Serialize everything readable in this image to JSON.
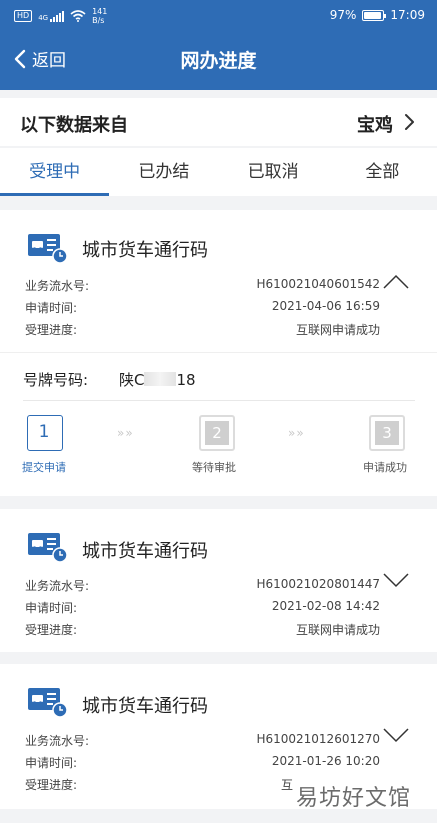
{
  "status_bar": {
    "net": "HD",
    "net_gen": "4G",
    "speed_value": "141",
    "speed_unit": "B/s",
    "battery": "97%",
    "time": "17:09",
    "battery_level": 0.97
  },
  "header": {
    "back_label": "返回",
    "title": "网办进度"
  },
  "source": {
    "label": "以下数据来自",
    "city": "宝鸡"
  },
  "tabs": [
    {
      "label": "受理中",
      "active": true
    },
    {
      "label": "已办结",
      "active": false
    },
    {
      "label": "已取消",
      "active": false
    },
    {
      "label": "全部",
      "active": false
    }
  ],
  "cards": [
    {
      "title": "城市货车通行码",
      "serial_label": "业务流水号:",
      "serial": "H610021040601542",
      "time_label": "申请时间:",
      "time": "2021-04-06 16:59",
      "progress_label": "受理进度:",
      "progress": "互联网申请成功",
      "expanded": true,
      "plate_label": "号牌号码:",
      "plate_prefix": "陕C",
      "plate_suffix": "18",
      "steps": [
        {
          "num": "1",
          "label": "提交申请",
          "active": true
        },
        {
          "num": "2",
          "label": "等待审批",
          "active": false
        },
        {
          "num": "3",
          "label": "申请成功",
          "active": false
        }
      ],
      "step_arrows": "»»"
    },
    {
      "title": "城市货车通行码",
      "serial_label": "业务流水号:",
      "serial": "H610021020801447",
      "time_label": "申请时间:",
      "time": "2021-02-08 14:42",
      "progress_label": "受理进度:",
      "progress": "互联网申请成功",
      "expanded": false
    },
    {
      "title": "城市货车通行码",
      "serial_label": "业务流水号:",
      "serial": "H610021012601270",
      "time_label": "申请时间:",
      "time": "2021-01-26 10:20",
      "progress_label": "受理进度:",
      "progress": "互",
      "expanded": false
    }
  ],
  "watermark": "易坊好文馆",
  "colors": {
    "accent": "#2e6cb5",
    "background": "#f2f3f5"
  }
}
